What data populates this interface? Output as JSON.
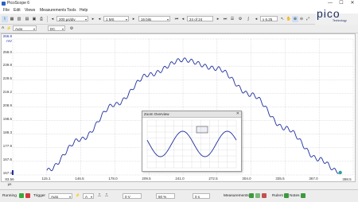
{
  "app": {
    "title": "PicoScope 6",
    "logo_text": "pico",
    "logo_sub": "Technology"
  },
  "window_controls": {
    "minimize": "—",
    "maximize": "☐",
    "close": "✕"
  },
  "menu": [
    "File",
    "Edit",
    "Views",
    "Measurements",
    "Tools",
    "Help"
  ],
  "toolbar1": {
    "timebase": "200 µs/div",
    "samples": "1 MS",
    "resolution": "16 bits",
    "buffer_position": "24 of 24",
    "zoom": "x 6.25"
  },
  "toolbar2": {
    "channel": "A",
    "range": "Auto",
    "coupling": "DC"
  },
  "plot": {
    "y_unit": "mV",
    "y_top_value": "266.8",
    "y_ticks": [
      "258.0",
      "239.8",
      "229.5",
      "219.2",
      "208.9",
      "198.6",
      "188.3",
      "177.9",
      "167.6",
      "157.3"
    ],
    "x_ticks": [
      "115.1",
      "146.5",
      "178.0",
      "209.5",
      "241.0",
      "272.5",
      "304.0",
      "335.5",
      "367.0"
    ],
    "x_left_label": "83.56",
    "x_unit": "µs",
    "x_right_label": "398.5",
    "colors": {
      "trace": "#1f2f9e",
      "grid": "#c8c8c8",
      "cursor": "#2aa198"
    }
  },
  "chart_data": {
    "type": "line",
    "x_range": [
      83.56,
      398.5
    ],
    "y_range": [
      157.3,
      266.8
    ],
    "xlabel": "µs",
    "ylabel": "mV",
    "series": [
      {
        "points": [
          [
            115.1,
            161
          ],
          [
            146.5,
            186
          ],
          [
            178.0,
            214
          ],
          [
            209.5,
            238
          ],
          [
            241.0,
            250
          ],
          [
            272.5,
            243
          ],
          [
            304.0,
            222
          ],
          [
            335.5,
            195
          ],
          [
            367.0,
            170
          ],
          [
            385.0,
            160
          ]
        ]
      }
    ],
    "grid": true
  },
  "zoom_overview": {
    "title": "Zoom Overview",
    "close": "✕"
  },
  "statusbar": {
    "run_state": "Running",
    "trigger_label": "Trigger",
    "trigger_mode": "Auto",
    "trigger_source": "A",
    "trigger_level": "0 V",
    "pretrigger": "50 %",
    "timing": "0 s",
    "measurements_label": "Measurements",
    "rulers_label": "Rulers",
    "notes_label": "Notes"
  }
}
